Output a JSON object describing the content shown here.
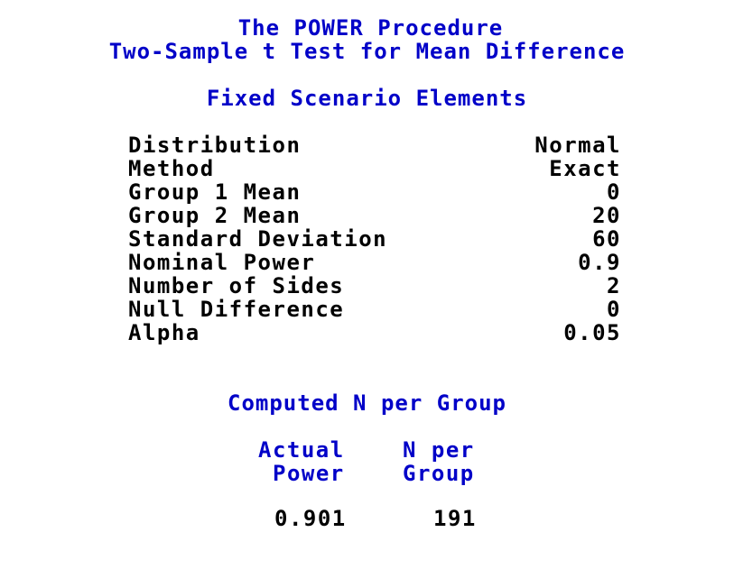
{
  "title": "The POWER Procedure",
  "subtitle": "Two-Sample t Test for Mean Difference",
  "fixed_section": {
    "heading": "Fixed Scenario Elements",
    "rows": [
      {
        "label": "Distribution",
        "value": "Normal"
      },
      {
        "label": "Method",
        "value": "Exact"
      },
      {
        "label": "Group 1 Mean",
        "value": "0"
      },
      {
        "label": "Group 2 Mean",
        "value": "20"
      },
      {
        "label": "Standard Deviation",
        "value": "60"
      },
      {
        "label": "Nominal Power",
        "value": "0.9"
      },
      {
        "label": "Number of Sides",
        "value": "2"
      },
      {
        "label": "Null Difference",
        "value": "0"
      },
      {
        "label": "Alpha",
        "value": "0.05"
      }
    ]
  },
  "computed_section": {
    "heading": "Computed N per Group",
    "columns": [
      {
        "header_line1": "Actual",
        "header_line2": "Power",
        "value": "0.901"
      },
      {
        "header_line1": "N per",
        "header_line2": "Group",
        "value": "191"
      }
    ]
  },
  "colors": {
    "heading": "#0000c8",
    "text": "#000000",
    "background": "#ffffff"
  }
}
